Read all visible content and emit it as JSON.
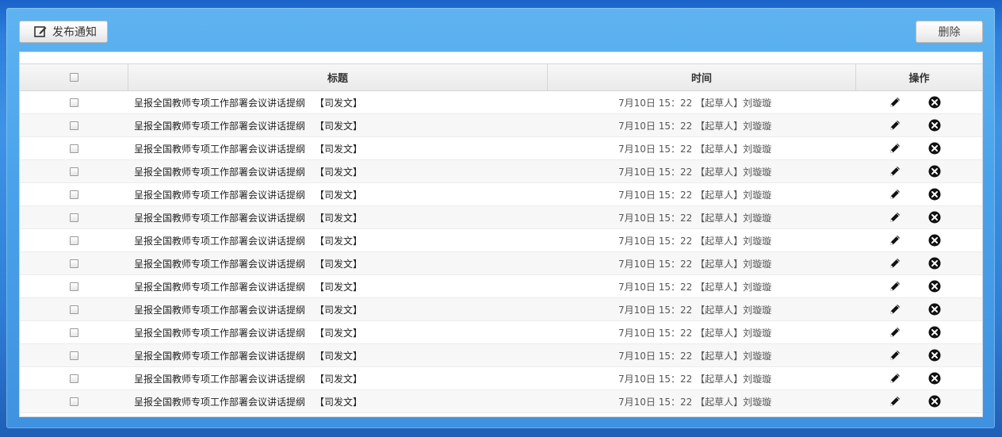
{
  "toolbar": {
    "publish_label": "发布通知",
    "publish_icon": "edit-icon",
    "delete_label": "删除"
  },
  "table": {
    "headers": {
      "title": "标题",
      "time": "时间",
      "ops": "操作"
    },
    "rows": [
      {
        "title": "呈报全国教师专项工作部署会议讲话提纲",
        "tag": "【司发文】",
        "time": "7月10日 15：22 【起草人】刘璇璇"
      },
      {
        "title": "呈报全国教师专项工作部署会议讲话提纲",
        "tag": "【司发文】",
        "time": "7月10日 15：22 【起草人】刘璇璇"
      },
      {
        "title": "呈报全国教师专项工作部署会议讲话提纲",
        "tag": "【司发文】",
        "time": "7月10日 15：22 【起草人】刘璇璇"
      },
      {
        "title": "呈报全国教师专项工作部署会议讲话提纲",
        "tag": "【司发文】",
        "time": "7月10日 15：22 【起草人】刘璇璇"
      },
      {
        "title": "呈报全国教师专项工作部署会议讲话提纲",
        "tag": "【司发文】",
        "time": "7月10日 15：22 【起草人】刘璇璇"
      },
      {
        "title": "呈报全国教师专项工作部署会议讲话提纲",
        "tag": "【司发文】",
        "time": "7月10日 15：22 【起草人】刘璇璇"
      },
      {
        "title": "呈报全国教师专项工作部署会议讲话提纲",
        "tag": "【司发文】",
        "time": "7月10日 15：22 【起草人】刘璇璇"
      },
      {
        "title": "呈报全国教师专项工作部署会议讲话提纲",
        "tag": "【司发文】",
        "time": "7月10日 15：22 【起草人】刘璇璇"
      },
      {
        "title": "呈报全国教师专项工作部署会议讲话提纲",
        "tag": "【司发文】",
        "time": "7月10日 15：22 【起草人】刘璇璇"
      },
      {
        "title": "呈报全国教师专项工作部署会议讲话提纲",
        "tag": "【司发文】",
        "time": "7月10日 15：22 【起草人】刘璇璇"
      },
      {
        "title": "呈报全国教师专项工作部署会议讲话提纲",
        "tag": "【司发文】",
        "time": "7月10日 15：22 【起草人】刘璇璇"
      },
      {
        "title": "呈报全国教师专项工作部署会议讲话提纲",
        "tag": "【司发文】",
        "time": "7月10日 15：22 【起草人】刘璇璇"
      },
      {
        "title": "呈报全国教师专项工作部署会议讲话提纲",
        "tag": "【司发文】",
        "time": "7月10日 15：22 【起草人】刘璇璇"
      },
      {
        "title": "呈报全国教师专项工作部署会议讲话提纲",
        "tag": "【司发文】",
        "time": "7月10日 15：22 【起草人】刘璇璇"
      }
    ],
    "row_icons": {
      "edit": "pencil-icon",
      "delete": "close-circle-icon"
    }
  }
}
